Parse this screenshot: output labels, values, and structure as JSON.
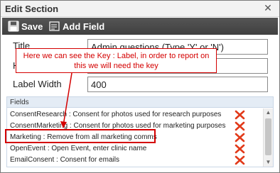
{
  "window": {
    "title": "Edit Section",
    "close_glyph": "✕"
  },
  "toolbar": {
    "save_label": "Save",
    "add_field_label": "Add Field"
  },
  "form": {
    "title_label": "Title",
    "title_value": "Admin questions (Type 'Y' or 'N')",
    "second_label": "H",
    "label_width_label": "Label Width",
    "label_width_value": "400"
  },
  "annotation": {
    "callout_text": "Here we can see the Key : Label, in order to report on this we will need the key"
  },
  "fields": {
    "header": "Fields",
    "items": [
      {
        "label": "ConsentResearch : Consent for photos used for research purposes"
      },
      {
        "label": "ConsentMarketing : Consent for photos used for marketing purposes"
      },
      {
        "label": "Marketing : Remove from all marketing comms"
      },
      {
        "label": "OpenEvent : Open Event, enter clinic name"
      },
      {
        "label": "EmailConsent : Consent for emails"
      }
    ]
  },
  "colors": {
    "toolbar_bg": "#4a4a4a",
    "annotation_red": "#d40000",
    "delete_icon_red": "#e23a1a",
    "fields_header_bg": "#e4ecf5"
  },
  "icons": {
    "save": "floppy-disk-icon",
    "add_field": "add-field-icon",
    "delete": "delete-x-icon",
    "close": "close-icon"
  }
}
